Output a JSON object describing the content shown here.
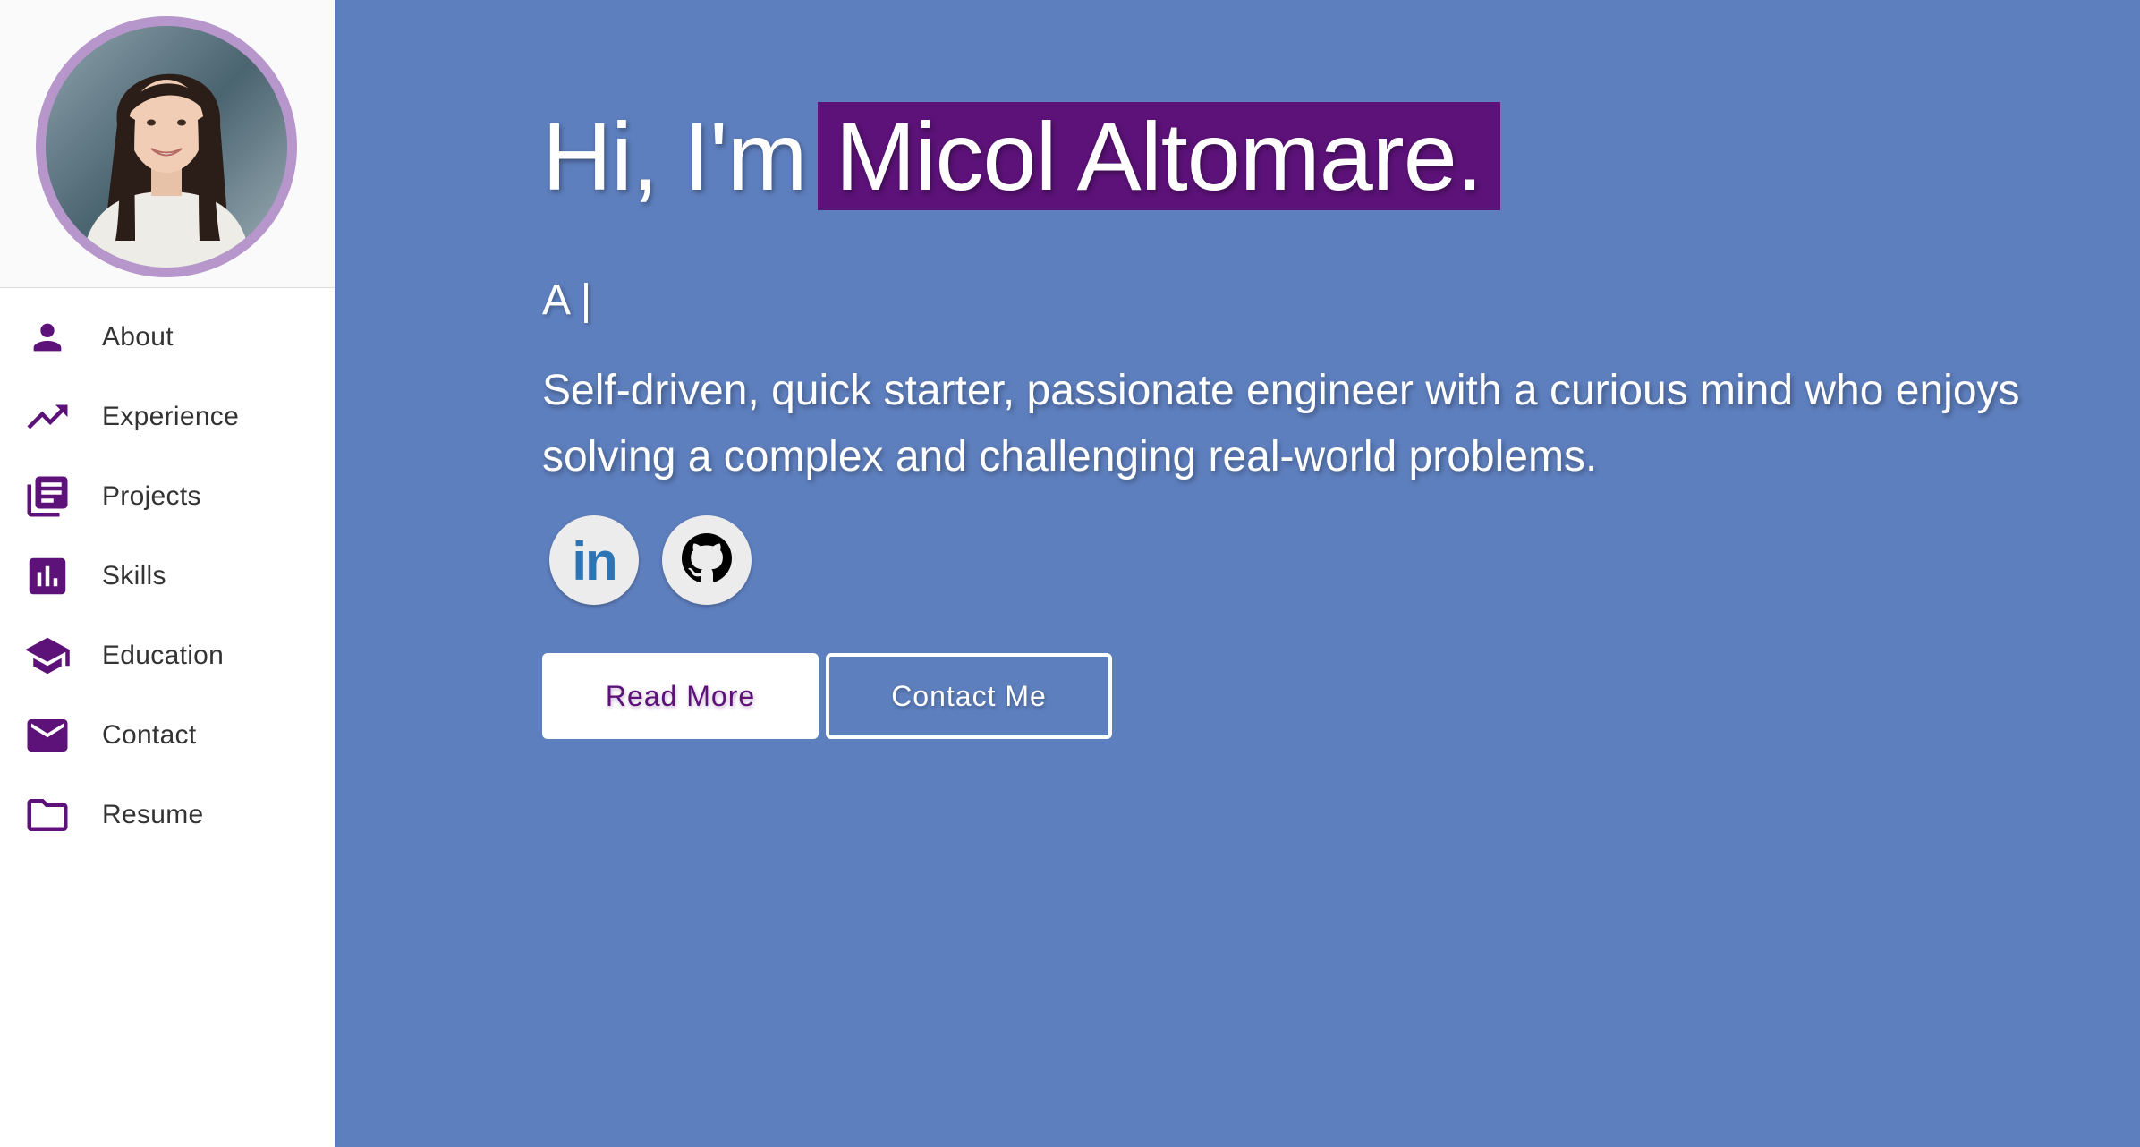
{
  "sidebar": {
    "items": [
      {
        "label": "About",
        "icon": "person-icon"
      },
      {
        "label": "Experience",
        "icon": "trending-up-icon"
      },
      {
        "label": "Projects",
        "icon": "library-books-icon"
      },
      {
        "label": "Skills",
        "icon": "bar-chart-icon"
      },
      {
        "label": "Education",
        "icon": "school-icon"
      },
      {
        "label": "Contact",
        "icon": "mail-icon"
      },
      {
        "label": "Resume",
        "icon": "folder-icon"
      }
    ]
  },
  "hero": {
    "greeting": "Hi, I'm",
    "name": "Micol Altomare.",
    "typing_text": "A |",
    "bio": "Self-driven, quick starter, passionate engineer with a curious mind who enjoys solving a complex and challenging real-world problems.",
    "social": [
      {
        "icon": "linkedin-icon",
        "text": "in"
      },
      {
        "icon": "github-icon"
      }
    ],
    "read_more_label": "Read More",
    "contact_me_label": "Contact Me"
  },
  "colors": {
    "background": "#5e7fbe",
    "accent": "#5c1278",
    "avatar_ring": "#b796cc",
    "linkedin": "#2e74b5"
  }
}
